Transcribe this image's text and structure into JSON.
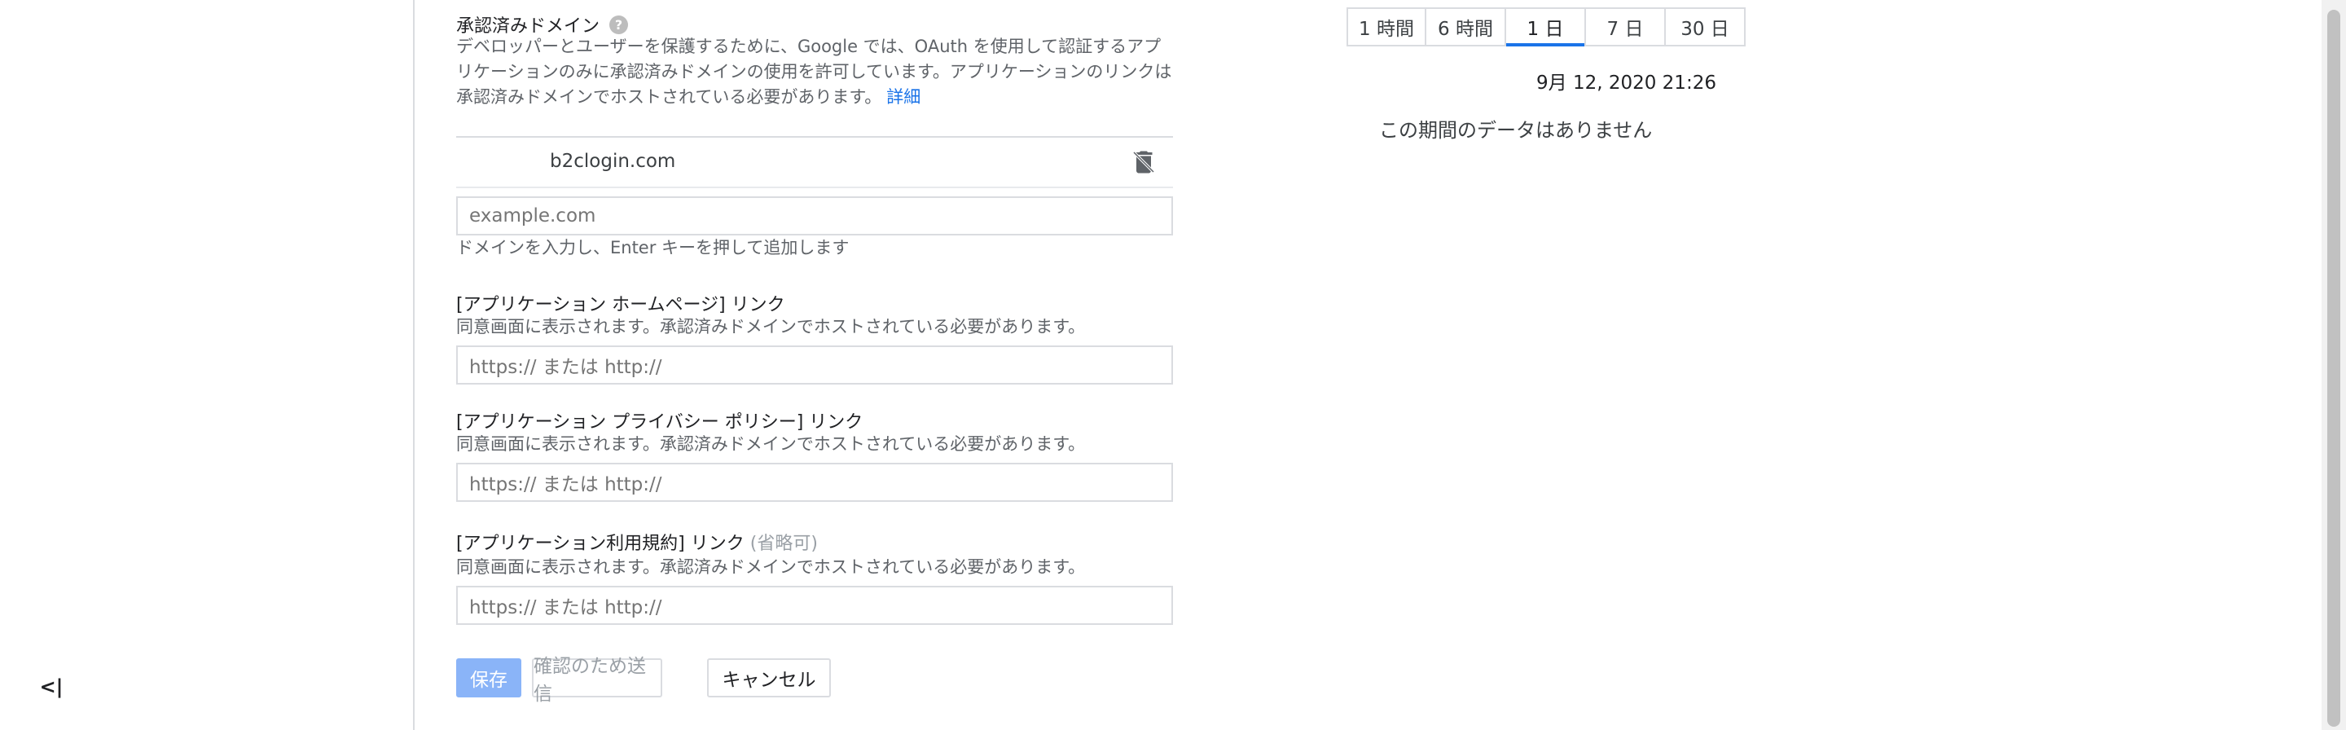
{
  "sidebar": {
    "collapse_label": "<|"
  },
  "domains": {
    "title": "承認済みドメイン",
    "help_icon": "?",
    "description": "デベロッパーとユーザーを保護するために、Google では、OAuth を使用して認証するアプリケーションのみに承認済みドメインの使用を許可しています。アプリケーションのリンクは承認済みドメインでホストされている必要があります。",
    "learn_more": "詳細",
    "items": [
      {
        "domain": "b2clogin.com"
      }
    ],
    "input_placeholder": "example.com",
    "input_hint": "ドメインを入力し、Enter キーを押して追加します"
  },
  "homepage": {
    "label": "[アプリケーション ホームページ] リンク",
    "sub": "同意画面に表示されます。承認済みドメインでホストされている必要があります。",
    "placeholder": "https:// または http://"
  },
  "privacy": {
    "label": "[アプリケーション プライバシー ポリシー] リンク",
    "sub": "同意画面に表示されます。承認済みドメインでホストされている必要があります。",
    "placeholder": "https:// または http://"
  },
  "terms": {
    "label": "[アプリケーション利用規約] リンク",
    "optional": "(省略可)",
    "sub": "同意画面に表示されます。承認済みドメインでホストされている必要があります。",
    "placeholder": "https:// または http://"
  },
  "actions": {
    "save": "保存",
    "verify": "確認のため送信",
    "cancel": "キャンセル"
  },
  "time_tabs": [
    {
      "label": "1 時間"
    },
    {
      "label": "6 時間"
    },
    {
      "label": "1 日",
      "active": true
    },
    {
      "label": "7 日"
    },
    {
      "label": "30 日"
    }
  ],
  "stats": {
    "timestamp": "9月 12, 2020 21:26",
    "no_data": "この期間のデータはありません"
  },
  "colors": {
    "accent": "#1a73e8",
    "save_button": "#8ab4f8"
  }
}
